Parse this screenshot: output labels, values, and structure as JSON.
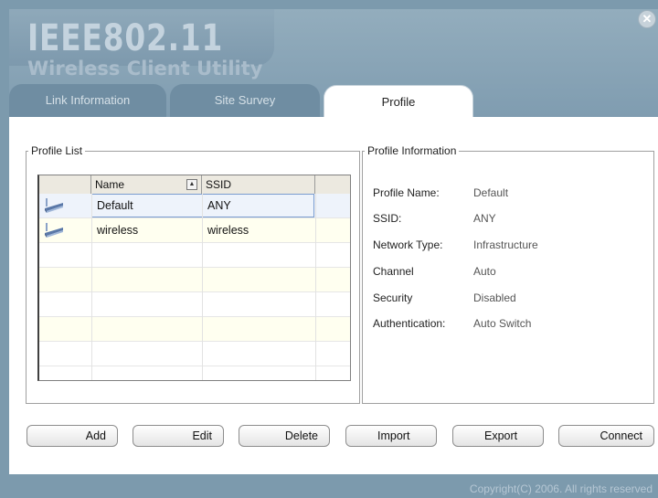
{
  "header": {
    "brand": "IEEE802.11",
    "subtitle": "Wireless Client Utility"
  },
  "window": {
    "close_icon": "close-icon"
  },
  "tabs": [
    {
      "label": "Link Information",
      "active": false
    },
    {
      "label": "Site Survey",
      "active": false
    },
    {
      "label": "Profile",
      "active": true
    }
  ],
  "profile_list": {
    "legend": "Profile List",
    "columns": [
      "Name",
      "SSID"
    ],
    "rows": [
      {
        "icon": "network-adapter-icon",
        "name": "Default",
        "ssid": "ANY",
        "selected": true
      },
      {
        "icon": "network-adapter-icon",
        "name": "wireless",
        "ssid": "wireless",
        "selected": false
      }
    ]
  },
  "profile_info": {
    "legend": "Profile Information",
    "fields": [
      {
        "label": "Profile Name:",
        "value": "Default"
      },
      {
        "label": "SSID:",
        "value": "ANY"
      },
      {
        "label": "Network Type:",
        "value": "Infrastructure"
      },
      {
        "label": "Channel",
        "value": "Auto"
      },
      {
        "label": "Security",
        "value": "Disabled"
      },
      {
        "label": "Authentication:",
        "value": "Auto Switch"
      }
    ]
  },
  "buttons": {
    "add": "Add",
    "edit": "Edit",
    "delete": "Delete",
    "import": "Import",
    "export": "Export",
    "connect": "Connect"
  },
  "footer": {
    "copyright": "Copyright(C) 2006. All rights reserved"
  },
  "colors": {
    "frame": "#7c9aad",
    "header": "#8fa9ba",
    "tab_inactive": "#6f8da2",
    "selection": "#7a9ccf",
    "row_alt": "#fffff0"
  }
}
